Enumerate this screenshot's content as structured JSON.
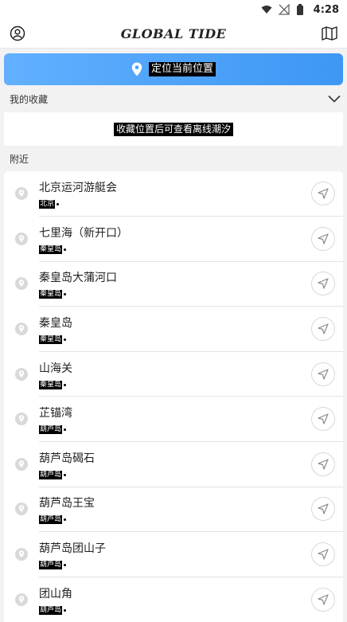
{
  "status_bar": {
    "time": "4:28"
  },
  "header": {
    "brand": "GLOBAL  TIDE"
  },
  "locate": {
    "label": "定位当前位置"
  },
  "favorites": {
    "title": "我的收藏",
    "empty_text": "收藏位置后可查看离线潮汐"
  },
  "nearby": {
    "title": "附近",
    "items": [
      {
        "name": "北京运河游艇会",
        "region": "北京"
      },
      {
        "name": "七里海（新开口）",
        "region": "秦皇岛"
      },
      {
        "name": "秦皇岛大蒲河口",
        "region": "秦皇岛"
      },
      {
        "name": "秦皇岛",
        "region": "秦皇岛"
      },
      {
        "name": "山海关",
        "region": "秦皇岛"
      },
      {
        "name": "芷锚湾",
        "region": "葫芦岛"
      },
      {
        "name": "葫芦岛碣石",
        "region": "葫芦岛"
      },
      {
        "name": "葫芦岛王宝",
        "region": "葫芦岛"
      },
      {
        "name": "葫芦岛团山子",
        "region": "葫芦岛"
      },
      {
        "name": "团山角",
        "region": "葫芦岛"
      }
    ]
  },
  "colors": {
    "accent": "#3d97f4",
    "background": "#f2f2f2"
  }
}
